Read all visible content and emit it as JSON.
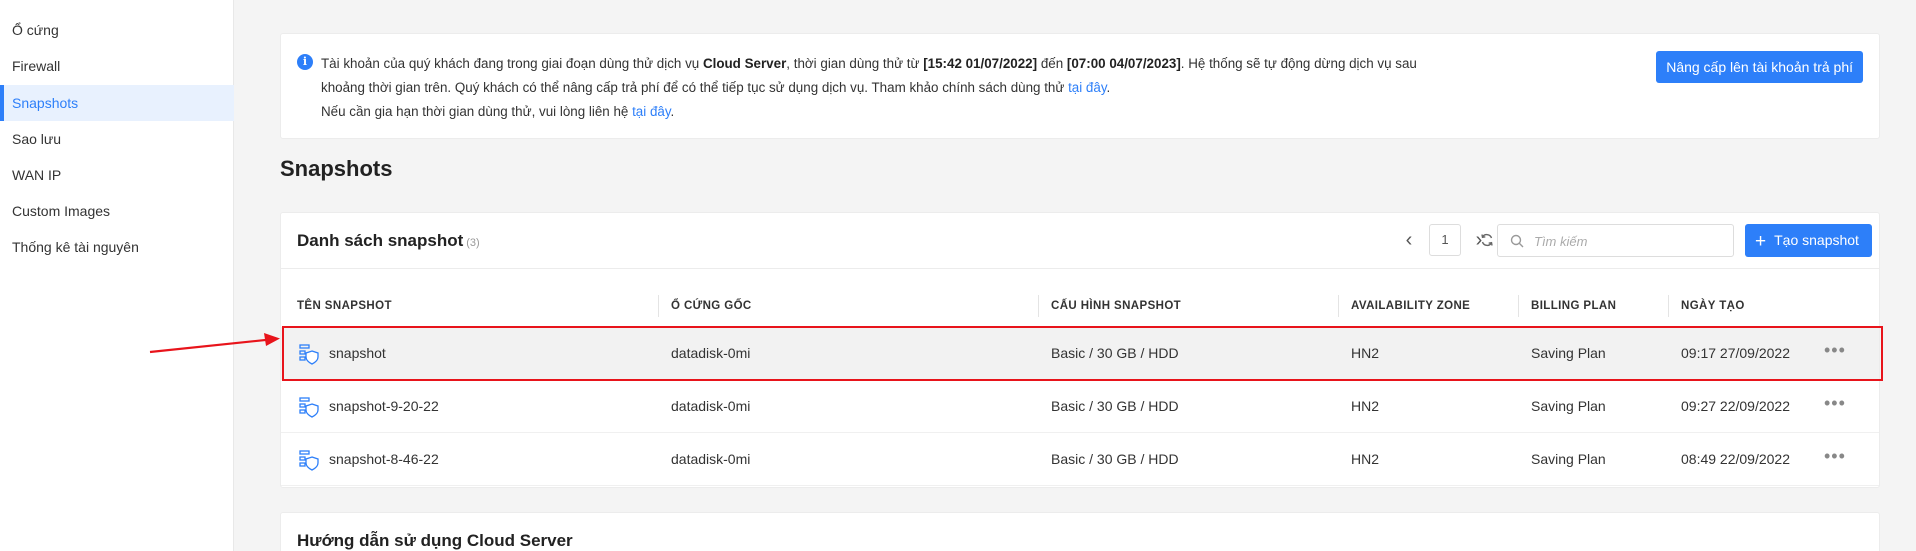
{
  "sidebar": {
    "items": [
      {
        "label": "Ổ cứng"
      },
      {
        "label": "Firewall"
      },
      {
        "label": "Snapshots"
      },
      {
        "label": "Sao lưu"
      },
      {
        "label": "WAN IP"
      },
      {
        "label": "Custom Images"
      },
      {
        "label": "Thống kê tài nguyên"
      }
    ],
    "active": "Snapshots"
  },
  "notice": {
    "line1_a": "Tài khoản của quý khách đang trong giai đoạn dùng thử dịch vụ ",
    "service": "Cloud Server",
    "line1_b": ", thời gian dùng thử từ ",
    "start": "[15:42 01/07/2022]",
    "line1_c": " đến ",
    "end": "[07:00 04/07/2023]",
    "line1_d": ". Hệ thống sẽ tự động dừng dịch vụ sau",
    "line2": "khoảng thời gian trên. Quý khách có thể nâng cấp trả phí để có thể tiếp tục sử dụng dịch vụ. Tham khảo chính sách dùng thử ",
    "line2_link": "tại đây",
    "line2_end": ".",
    "line3": "Nếu cần gia hạn thời gian dùng thử, vui lòng liên hệ ",
    "line3_link": "tại đây",
    "line3_end": ".",
    "upgrade_label": "Nâng cấp lên tài khoản trả phí"
  },
  "page_title": "Snapshots",
  "list": {
    "title": "Danh sách snapshot",
    "count": "(3)",
    "page": "1",
    "prev": "‹",
    "next": "›",
    "refresh": "⟳",
    "search_placeholder": "Tìm kiếm",
    "create_label": "Tạo snapshot",
    "columns": [
      "TÊN SNAPSHOT",
      "Ổ CỨNG GỐC",
      "CẤU HÌNH SNAPSHOT",
      "AVAILABILITY ZONE",
      "BILLING PLAN",
      "NGÀY TẠO"
    ],
    "rows": [
      {
        "name": "snapshot",
        "disk": "datadisk-0mi",
        "config": "Basic / 30 GB / HDD",
        "zone": "HN2",
        "plan": "Saving Plan",
        "date": "09:17 27/09/2022",
        "more": "•••"
      },
      {
        "name": "snapshot-9-20-22",
        "disk": "datadisk-0mi",
        "config": "Basic / 30 GB / HDD",
        "zone": "HN2",
        "plan": "Saving Plan",
        "date": "09:27 22/09/2022",
        "more": "•••"
      },
      {
        "name": "snapshot-8-46-22",
        "disk": "datadisk-0mi",
        "config": "Basic / 30 GB / HDD",
        "zone": "HN2",
        "plan": "Saving Plan",
        "date": "08:49 22/09/2022",
        "more": "•••"
      }
    ]
  },
  "guide": {
    "title": "Hướng dẫn sử dụng Cloud Server"
  },
  "colors": {
    "accent": "#2d7ff9",
    "highlight_border": "#e8141b"
  }
}
